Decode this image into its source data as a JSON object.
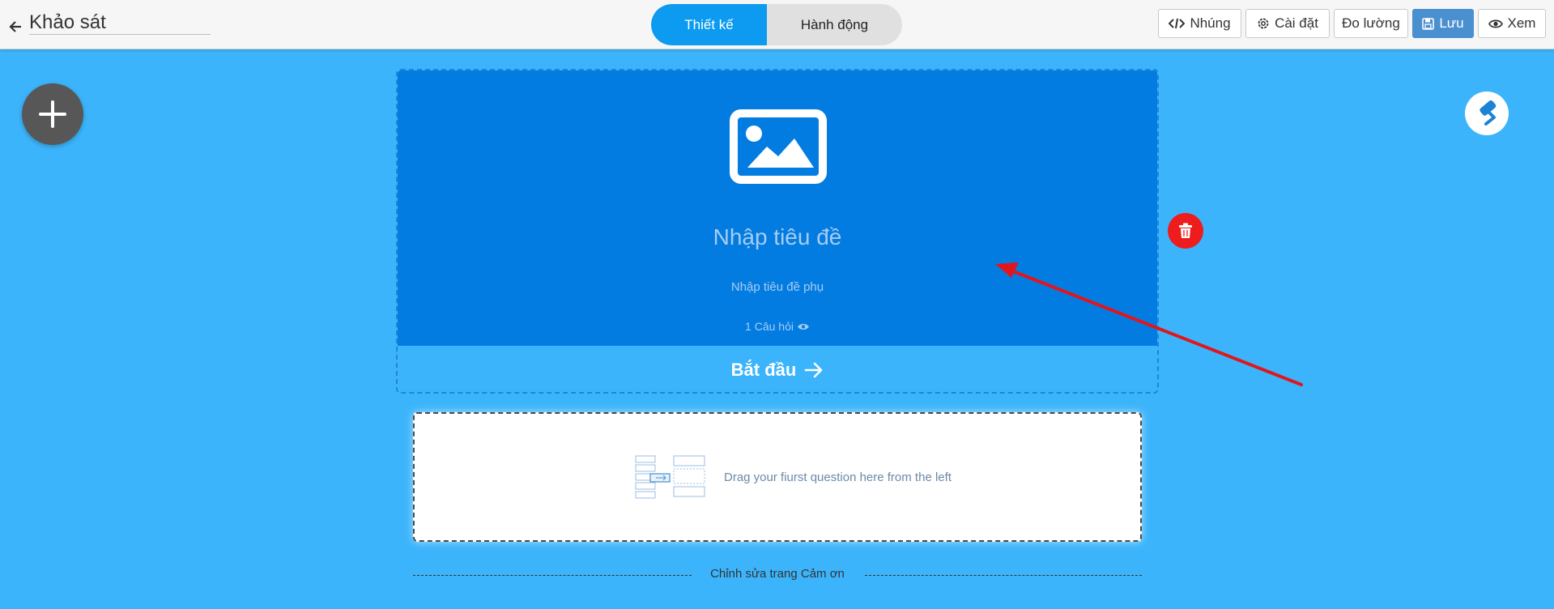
{
  "header": {
    "title": "Khảo sát",
    "tabs": [
      {
        "label": "Thiết kế",
        "active": true
      },
      {
        "label": "Hành động",
        "active": false
      }
    ],
    "buttons": {
      "embed": "Nhúng",
      "settings": "Cài đặt",
      "measure": "Đo lường",
      "save": "Lưu",
      "view": "Xem"
    }
  },
  "welcome": {
    "title_placeholder": "Nhập tiêu đề",
    "subtitle_placeholder": "Nhập tiêu đề phụ",
    "question_count": "1 Câu hỏi",
    "start_label": "Bắt đầu"
  },
  "dropzone": {
    "text": "Drag your fiurst question here from the left"
  },
  "thankyou": {
    "link": "Chỉnh sửa trang Cảm ơn"
  },
  "colors": {
    "canvas": "#3cb4fb",
    "welcome_bg": "#037ce2",
    "active_tab": "#0c9bf0",
    "save_button": "#4a8fcf",
    "delete": "#ee1c1c",
    "annotation_arrow": "#e0161c"
  },
  "icons": [
    "back-arrow-icon",
    "code-icon",
    "gear-icon",
    "save-icon",
    "eye-icon",
    "plus-icon",
    "paint-roller-icon",
    "image-icon",
    "arrow-right-icon",
    "trash-icon"
  ]
}
